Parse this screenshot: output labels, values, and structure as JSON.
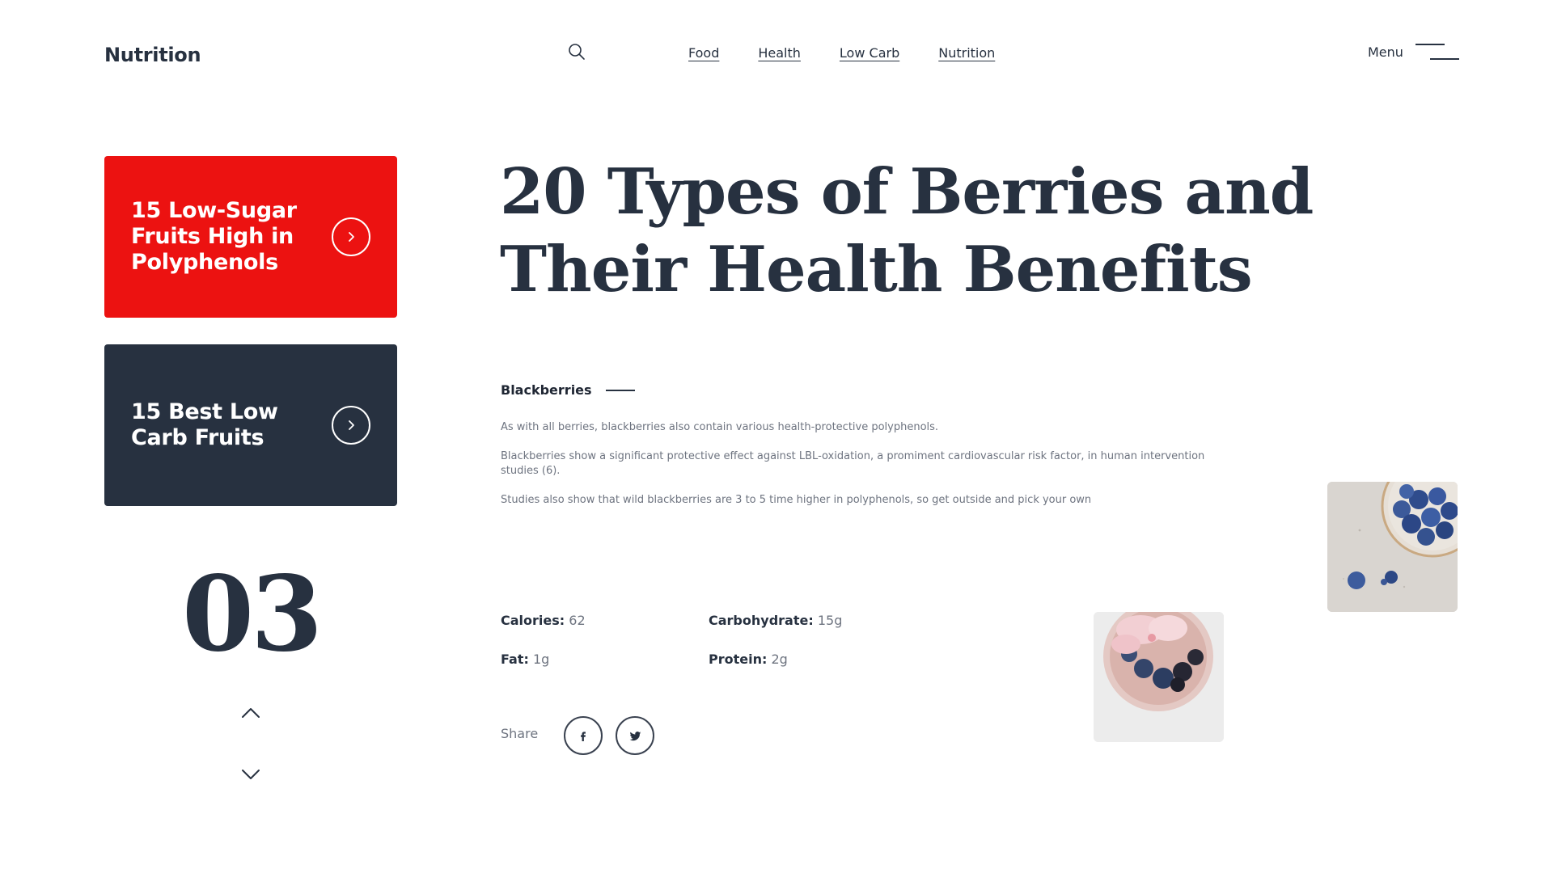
{
  "header": {
    "logo": "Nutrition",
    "nav": [
      "Food",
      "Health",
      "Low Carb",
      "Nutrition"
    ],
    "menu_label": "Menu",
    "search_icon": "search-icon",
    "menu_icon": "hamburger-menu-icon"
  },
  "sidebar": {
    "cards": [
      {
        "title": "15 Low-Sugar Fruits High in Polyphenols",
        "color": "#ec1211"
      },
      {
        "title": "15 Best Low Carb Fruits",
        "color": "#273140"
      }
    ],
    "page_number": "03"
  },
  "article": {
    "headline": "20 Types of Berries and Their Health Benefits",
    "section": "Blackberries",
    "paragraphs": [
      "As with all berries, blackberries also contain  various health-protective polyphenols.",
      "Blackberries show a significant protective effect against LBL-oxidation, a promiment cardiovascular risk factor, in human intervention studies (6).",
      "Studies also show that wild blackberries are 3 to 5 time higher in polyphenols, so get outside and pick your own"
    ],
    "nutrition": {
      "calories": {
        "label": "Calories:",
        "value": "62"
      },
      "carbohydrate": {
        "label": "Carbohydrate:",
        "value": "15g"
      },
      "fat": {
        "label": "Fat:",
        "value": "1g"
      },
      "protein": {
        "label": "Protein:",
        "value": "2g"
      }
    },
    "share_label": "Share",
    "social_icons": [
      "facebook-icon",
      "twitter-icon"
    ]
  },
  "colors": {
    "accent_red": "#ec1211",
    "navy": "#273140",
    "muted_text": "#6e7480"
  }
}
